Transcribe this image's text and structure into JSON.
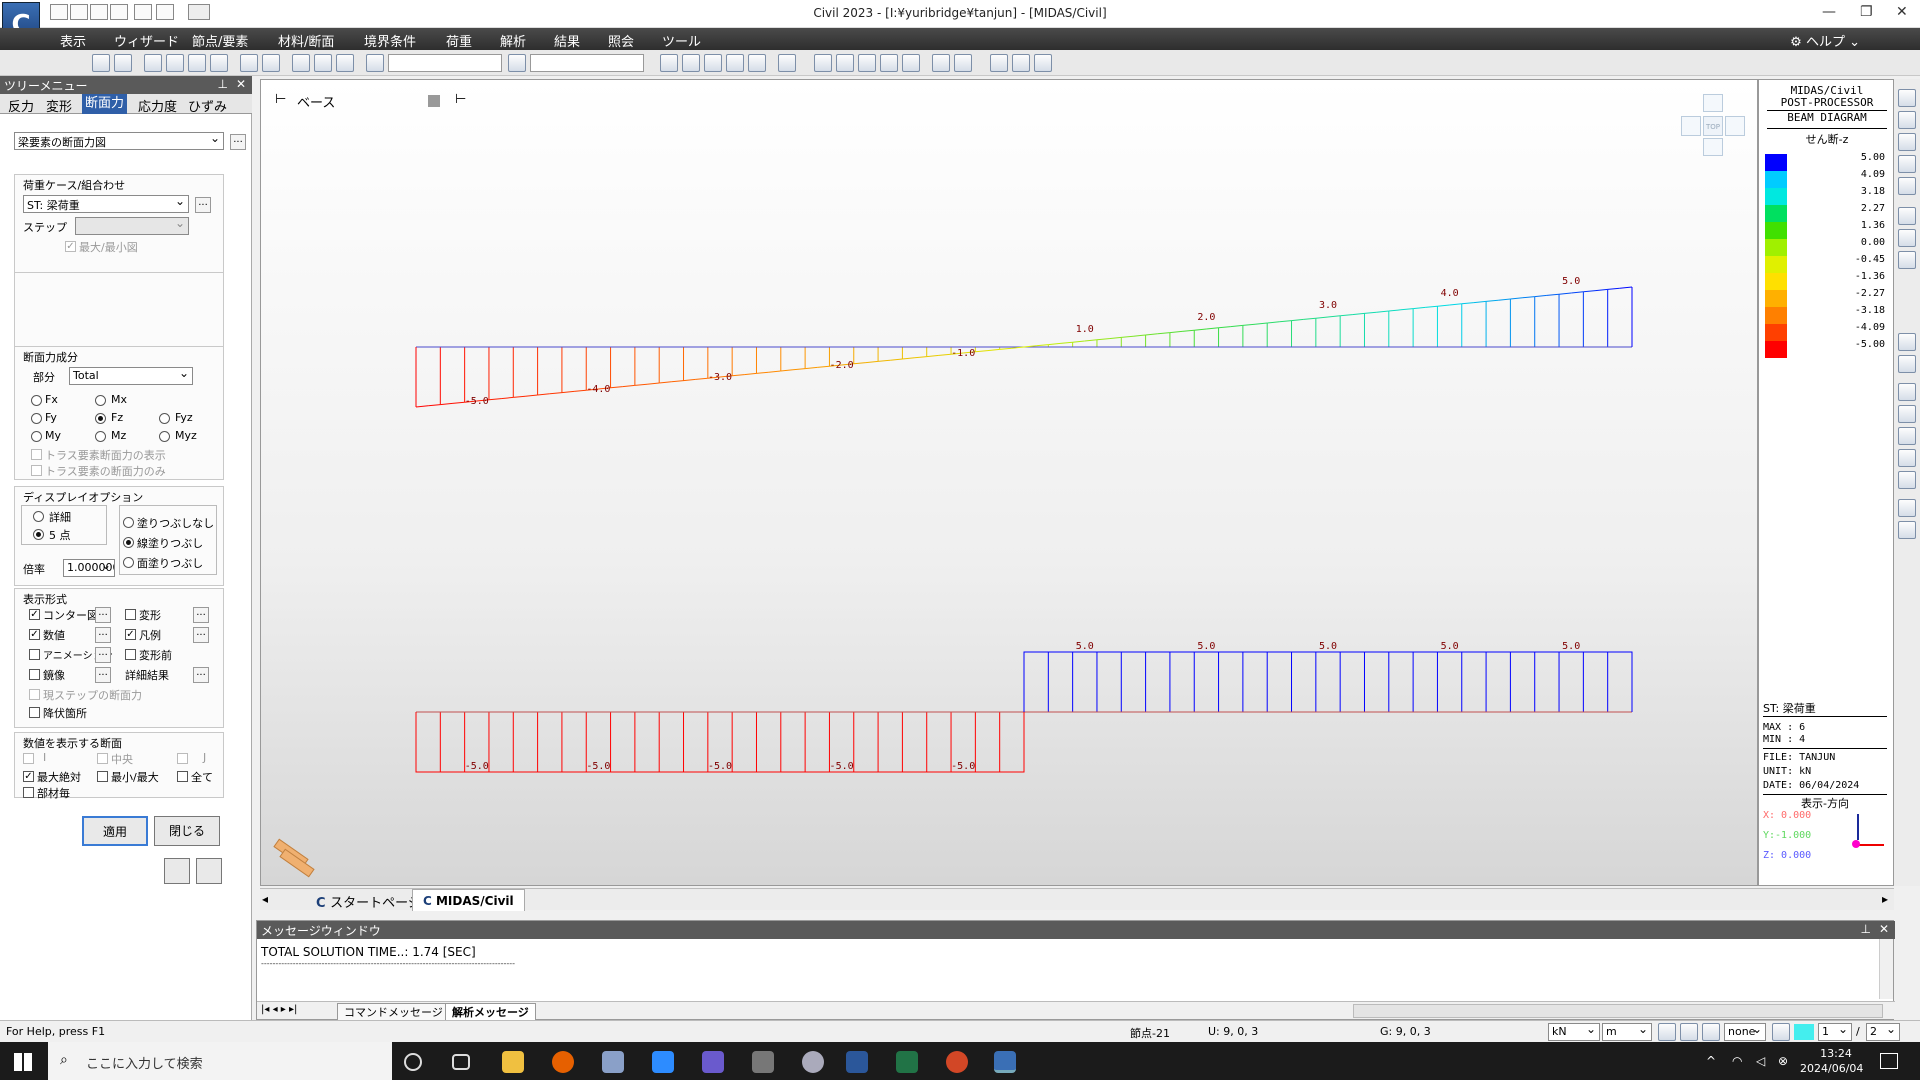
{
  "window": {
    "title": "Civil 2023 - [I:¥yuribridge¥tanjun] - [MIDAS/Civil]",
    "logo": "C"
  },
  "menu": [
    "表示",
    "ウィザード",
    "節点/要素",
    "材料/断面",
    "境界条件",
    "荷重",
    "解析",
    "結果",
    "照会",
    "ツール"
  ],
  "menu_help": "ヘルプ",
  "tree": {
    "header": "ツリーメニュー",
    "tabs": [
      "反力",
      "変形",
      "断面力",
      "応力度",
      "ひずみ"
    ],
    "active_tab": "断面力",
    "diagram_type": "梁要素の断面力図",
    "load_case_title": "荷重ケース/組合わせ",
    "load_case": "ST: 梁荷重",
    "step_label": "ステップ",
    "maxmin_label": "最大/最小図",
    "component_title": "断面力成分",
    "part_label": "部分",
    "part_value": "Total",
    "components": [
      "Fx",
      "Mx",
      "Fy",
      "Fz",
      "Fyz",
      "My",
      "Mz",
      "Myz"
    ],
    "selected_component": "Fz",
    "truss_show": "トラス要素断面力の表示",
    "truss_only": "トラス要素の断面力のみ",
    "display_title": "ディスプレイオプション",
    "detail": "詳細",
    "five_points": "5 点",
    "no_fill": "塗りつぶしなし",
    "line_fill": "線塗りつぶし",
    "face_fill": "面塗りつぶし",
    "scale_label": "倍率",
    "scale_value": "1.000000",
    "format_title": "表示形式",
    "contour": "コンター図",
    "deform": "変形",
    "values": "数値",
    "legend": "凡例",
    "animation": "アニメーション",
    "before_deform": "変形前",
    "mirror": "鏡像",
    "detail_result": "詳細結果",
    "current_step": "現ステップの断面力",
    "yield": "降伏箇所",
    "value_sections_title": "数値を表示する断面",
    "sec_i": "I",
    "sec_center": "中央",
    "sec_j": "J",
    "abs_max": "最大絶対",
    "minmax": "最小/最大",
    "all": "全て",
    "per_member": "部材毎",
    "apply": "適用",
    "close": "閉じる"
  },
  "viewport": {
    "base_label": "ベース",
    "top_label": "TOP"
  },
  "chart_data": [
    {
      "type": "area",
      "description_source": "upper beam shear diagram",
      "labels": [
        "-5.0",
        "-4.0",
        "-3.0",
        "-2.0",
        "-1.0",
        "1.0",
        "2.0",
        "3.0",
        "4.0",
        "5.0"
      ],
      "x": [
        0.5,
        1.5,
        2.5,
        3.5,
        4.5,
        5.5,
        6.5,
        7.5,
        8.5,
        9.5
      ],
      "values": [
        -5.0,
        -4.0,
        -3.0,
        -2.0,
        -1.0,
        1.0,
        2.0,
        3.0,
        4.0,
        5.0
      ],
      "ylim": [
        -5,
        5
      ]
    },
    {
      "type": "bar",
      "description_source": "lower beam shear diagram",
      "labels": [
        "-5.0",
        "-5.0",
        "-5.0",
        "-5.0",
        "-5.0",
        "5.0",
        "5.0",
        "5.0",
        "5.0",
        "5.0"
      ],
      "x": [
        0.5,
        1.5,
        2.5,
        3.5,
        4.5,
        5.5,
        6.5,
        7.5,
        8.5,
        9.5
      ],
      "values": [
        -5.0,
        -5.0,
        -5.0,
        -5.0,
        -5.0,
        5.0,
        5.0,
        5.0,
        5.0,
        5.0
      ],
      "ylim": [
        -5,
        5
      ]
    }
  ],
  "legend": {
    "lines": [
      "MIDAS/Civil",
      "POST-PROCESSOR",
      "BEAM DIAGRAM"
    ],
    "title": "せん断-z",
    "values": [
      "5.00",
      "4.09",
      "3.18",
      "2.27",
      "1.36",
      "0.00",
      "-0.45",
      "-1.36",
      "-2.27",
      "-3.18",
      "-4.09",
      "-5.00"
    ],
    "colors": [
      "#0000ff",
      "#00ccff",
      "#00e8e0",
      "#00e060",
      "#40e000",
      "#a0f000",
      "#e0f000",
      "#ffe000",
      "#ffb000",
      "#ff8000",
      "#ff4000",
      "#ff0000"
    ],
    "case": "ST: 梁荷重",
    "max": "MAX : 6",
    "min": "MIN : 4",
    "file": "FILE: TANJUN",
    "unit": "UNIT: kN",
    "date": "DATE: 06/04/2024",
    "direction": "表示-方向",
    "x": "X: 0.000",
    "y": "Y:-1.000",
    "z": "Z: 0.000"
  },
  "tabs": [
    "スタートページ",
    "MIDAS/Civil"
  ],
  "messages": {
    "header": "メッセージウィンドウ",
    "line1": "TOTAL SOLUTION TIME..:     1.74 [SEC]",
    "line2": "----------------------------------------------------------------------------------------",
    "tab1": "コマンドメッセージ",
    "tab2": "解析メッセージ"
  },
  "status": {
    "help": "For Help, press F1",
    "node": "節点-21",
    "u": "U: 9, 0, 3",
    "g": "G: 9, 0, 3",
    "force_unit": "kN",
    "len_unit": "m",
    "none": "none",
    "page": "1",
    "pages": "2"
  },
  "taskbar": {
    "search": "ここに入力して検索",
    "time": "13:24",
    "date": "2024/06/04"
  }
}
